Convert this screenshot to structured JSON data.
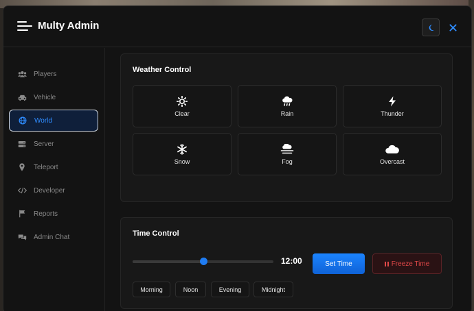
{
  "app": {
    "title": "Multy Admin"
  },
  "colors": {
    "accent": "#1f7cf2",
    "danger": "#e04848",
    "panel": "#131313"
  },
  "sidebar": {
    "items": [
      {
        "label": "Players",
        "icon": "users-icon"
      },
      {
        "label": "Vehicle",
        "icon": "car-icon"
      },
      {
        "label": "World",
        "icon": "globe-icon",
        "active": true
      },
      {
        "label": "Server",
        "icon": "server-icon"
      },
      {
        "label": "Teleport",
        "icon": "map-pin-icon"
      },
      {
        "label": "Developer",
        "icon": "code-icon"
      },
      {
        "label": "Reports",
        "icon": "flag-icon"
      },
      {
        "label": "Admin Chat",
        "icon": "chat-icon"
      }
    ]
  },
  "weather": {
    "title": "Weather Control",
    "options": [
      {
        "label": "Clear",
        "icon": "sun-icon"
      },
      {
        "label": "Rain",
        "icon": "cloud-rain-icon"
      },
      {
        "label": "Thunder",
        "icon": "bolt-icon"
      },
      {
        "label": "Snow",
        "icon": "snowflake-icon"
      },
      {
        "label": "Fog",
        "icon": "fog-icon"
      },
      {
        "label": "Overcast",
        "icon": "cloud-icon"
      }
    ]
  },
  "time": {
    "title": "Time Control",
    "value": "12:00",
    "slider_fraction": 0.5,
    "set_label": "Set Time",
    "freeze_label": "Freeze Time",
    "presets": [
      "Morning",
      "Noon",
      "Evening",
      "Midnight"
    ]
  }
}
